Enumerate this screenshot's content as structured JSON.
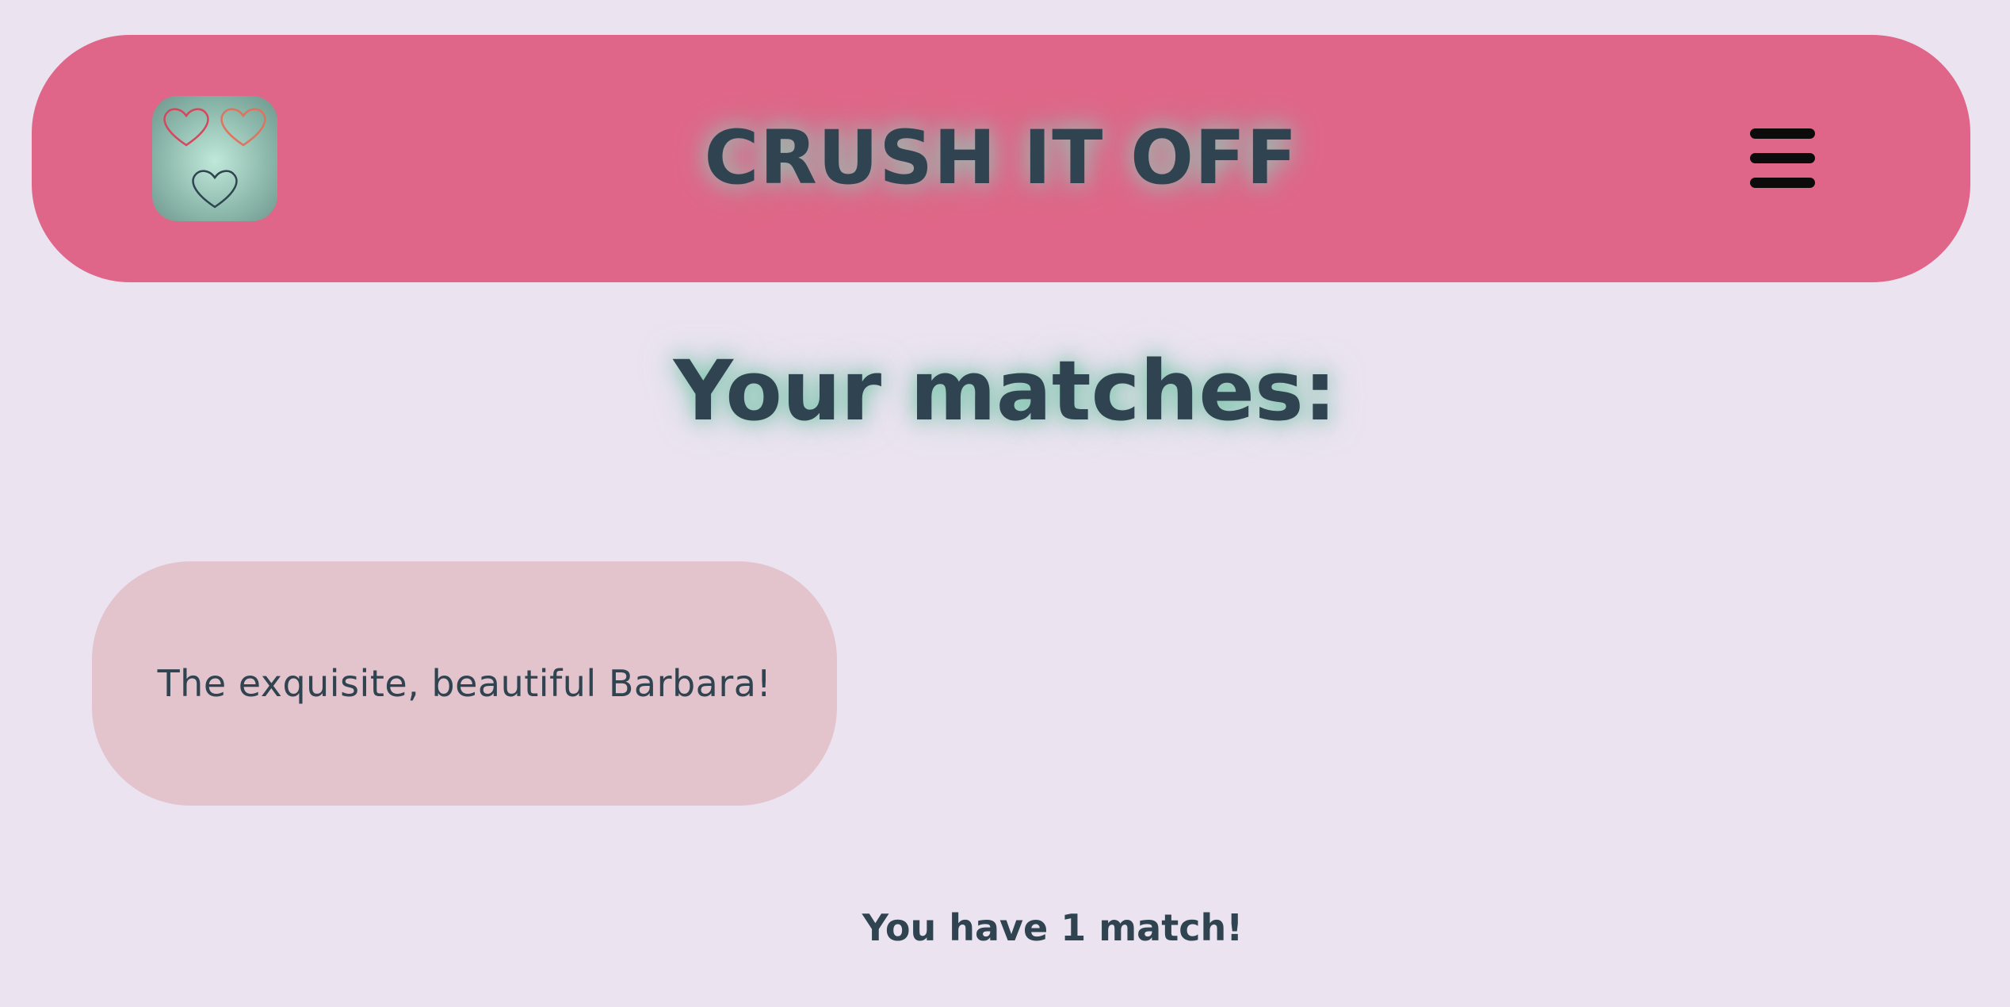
{
  "header": {
    "title": "CRUSH IT OFF",
    "logo_icon": "hearts-logo-icon",
    "menu_icon": "hamburger-menu-icon",
    "colors": {
      "background": "#e06689",
      "logo_hearts": [
        "#d6475e",
        "#e0735b",
        "#2f4450"
      ]
    }
  },
  "main": {
    "title": "Your matches:",
    "matches": [
      {
        "label": "The exquisite, beautiful Barbara!"
      }
    ],
    "match_count_text": "You have 1 match!"
  },
  "colors": {
    "page_background": "#ebe3f0",
    "text": "#2f4450",
    "card_background": "#e3c4cc",
    "glow": "#96beb2"
  }
}
